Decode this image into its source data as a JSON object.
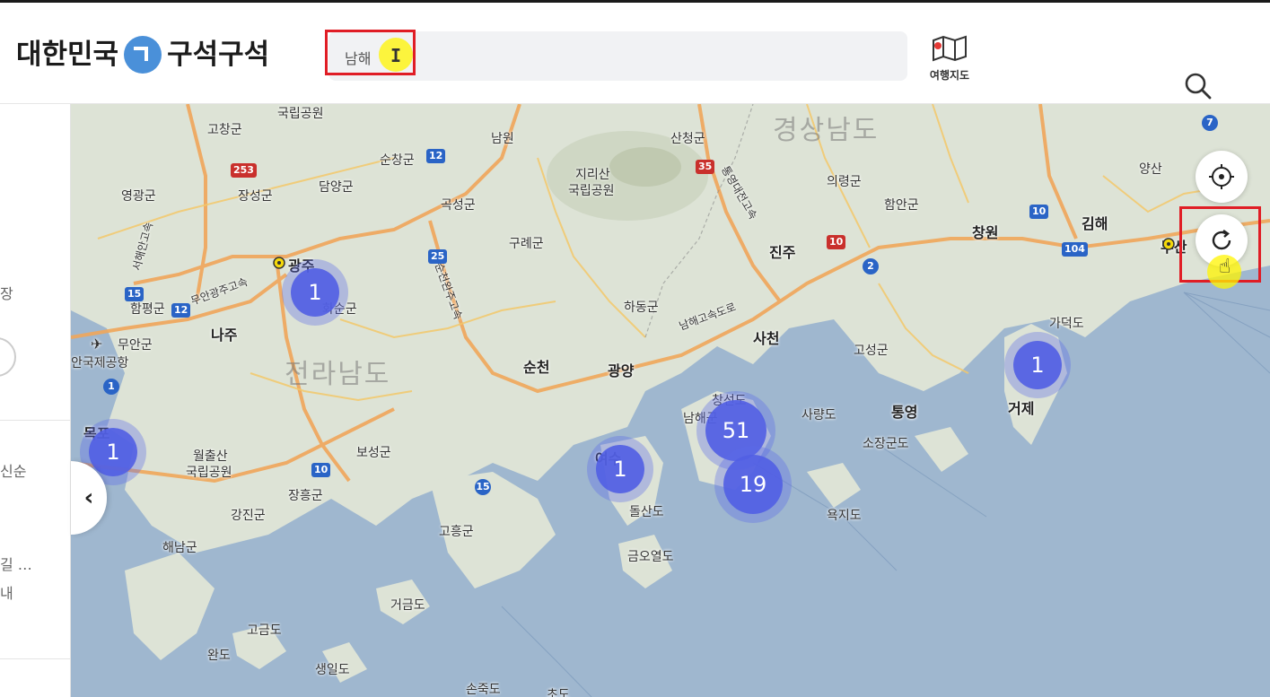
{
  "header": {
    "logo_left": "대한민국",
    "logo_right": "구석구석",
    "search_value": "남해",
    "search_placeholder": "",
    "travel_map_label": "여행지도"
  },
  "sidebar": {
    "items": [
      "장",
      "신순",
      "길 …",
      "내"
    ]
  },
  "map": {
    "regions": [
      "경상남도",
      "전라남도"
    ],
    "places": [
      "국립공원",
      "고창군",
      "남원",
      "산청군",
      "순창군",
      "지리산",
      "국립공원",
      "영광군",
      "장성군",
      "담양군",
      "곡성군",
      "의령군",
      "함안군",
      "양산",
      "광주",
      "구례군",
      "진주",
      "창원",
      "김해",
      "화순군",
      "하동군",
      "함평군",
      "무안군",
      "나주",
      "사천",
      "고성군",
      "가덕도",
      "안국제공항",
      "순천",
      "광양",
      "거제",
      "목포",
      "창선도",
      "남해군",
      "사량도",
      "통영",
      "보성군",
      "소장군도",
      "월출산",
      "국립공원",
      "여수",
      "장흥군",
      "강진군",
      "돌산도",
      "욕지도",
      "고흥군",
      "해남군",
      "금오열도",
      "거금도",
      "고금도",
      "완도",
      "생일도",
      "손죽도",
      "부산",
      "남해고속도로",
      "서해안고속",
      "무안광주고속",
      "순천완주고속",
      "통영대전고속",
      "초도"
    ],
    "routes": [
      "253",
      "12",
      "35",
      "15",
      "12",
      "25",
      "10",
      "10",
      "104",
      "2",
      "1",
      "15",
      "10",
      "7"
    ],
    "clusters": [
      {
        "label": "1"
      },
      {
        "label": "1"
      },
      {
        "label": "51"
      },
      {
        "label": "19"
      },
      {
        "label": "1"
      },
      {
        "label": "1"
      }
    ],
    "collapse_icon": "chevron-left-icon",
    "locate_icon": "crosshair-icon",
    "refresh_icon": "refresh-icon"
  },
  "colors": {
    "highlight": "#e01d25",
    "cluster": "#5260e4",
    "sea": "#9fb7cf",
    "land": "#dde3d6",
    "logo_mark": "#4a90d9"
  }
}
